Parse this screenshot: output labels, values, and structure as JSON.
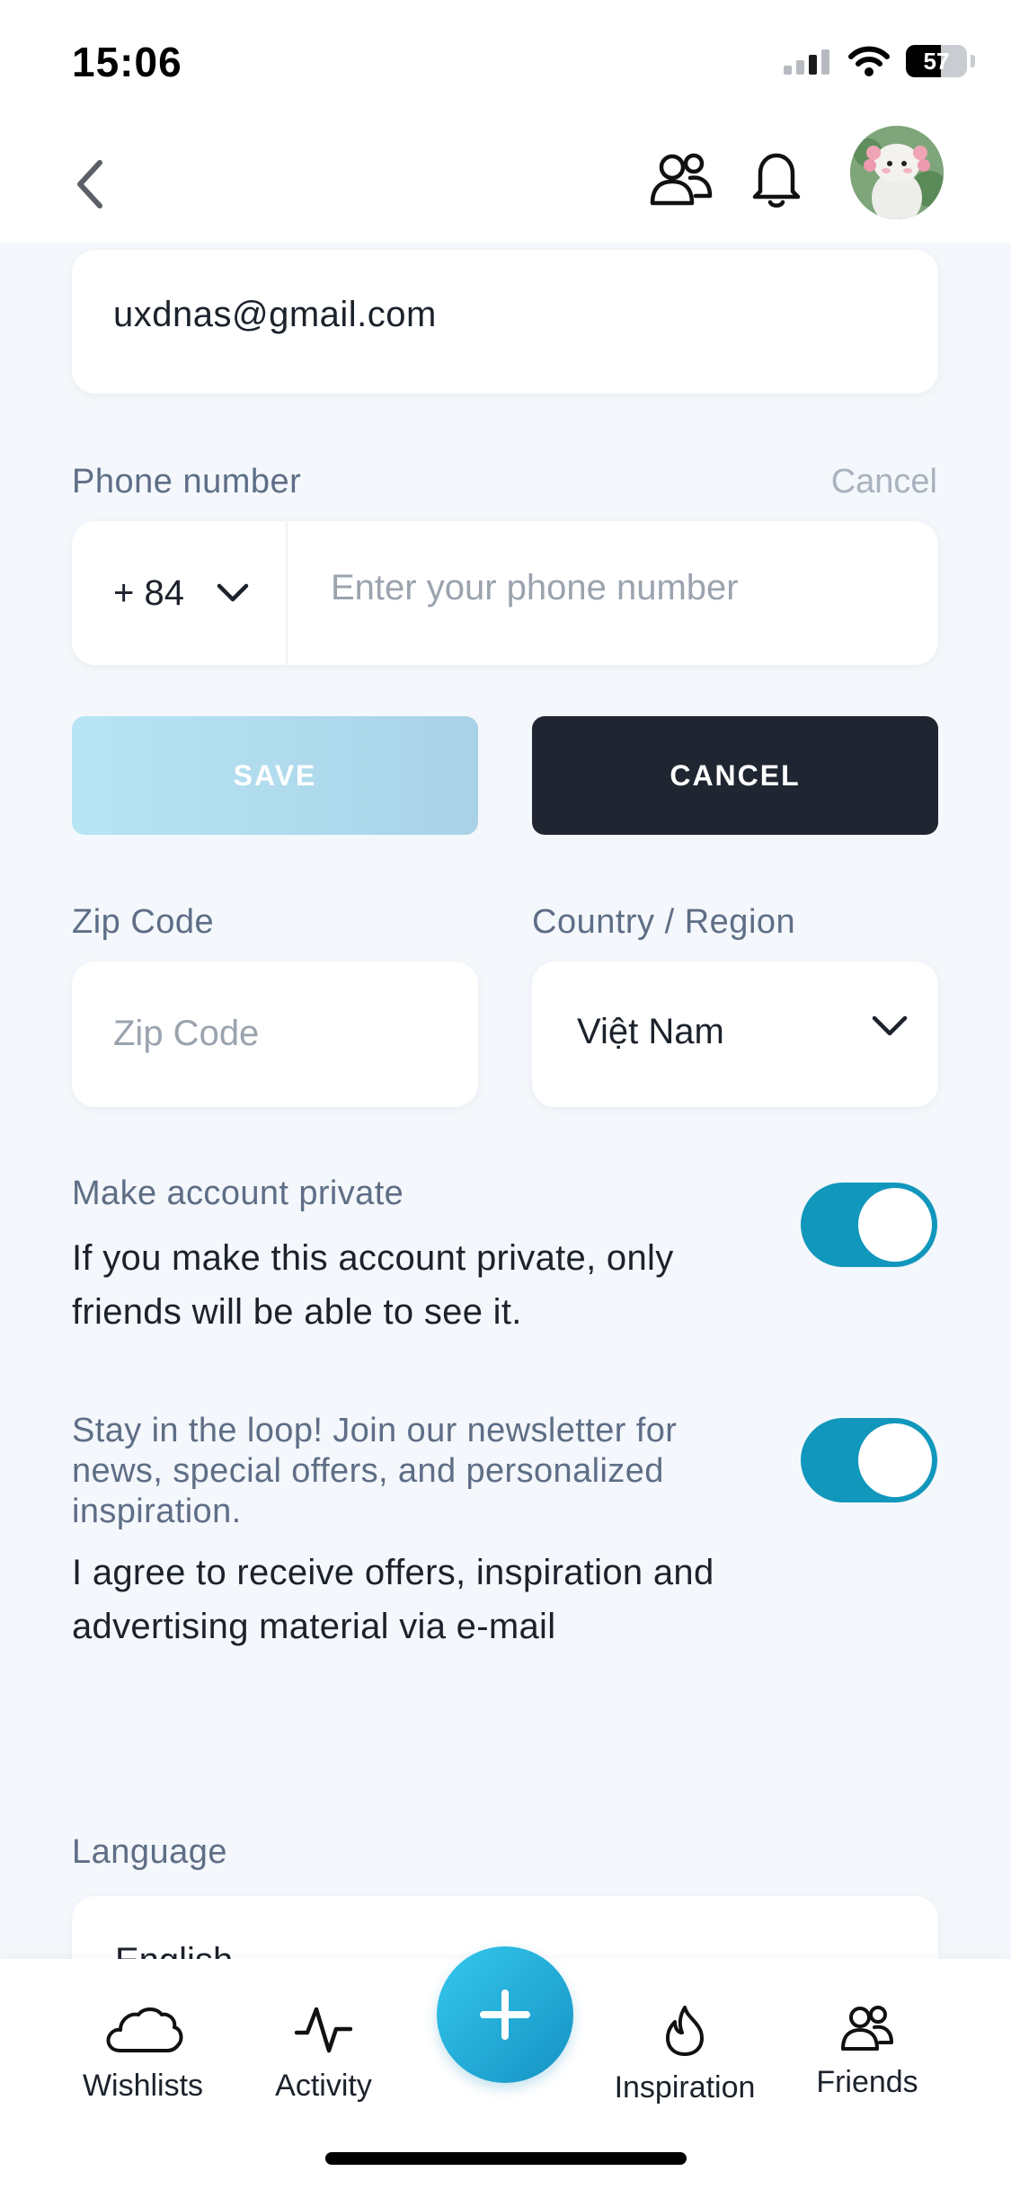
{
  "status_bar": {
    "time": "15:06",
    "battery": "57"
  },
  "account": {
    "email": "uxdnas@gmail.com"
  },
  "phone": {
    "label": "Phone number",
    "cancel_link": "Cancel",
    "country_code": "+ 84",
    "placeholder": "Enter your phone number"
  },
  "buttons": {
    "save": "SAVE",
    "cancel": "CANCEL"
  },
  "zip": {
    "label": "Zip Code",
    "placeholder": "Zip Code"
  },
  "country": {
    "label": "Country / Region",
    "value": "Việt Nam"
  },
  "privacy": {
    "label": "Make account private",
    "description": "If you make this account private, only friends will be able to see it.",
    "enabled": true
  },
  "newsletter": {
    "label": "Stay in the loop! Join our newsletter for news, special offers, and personalized inspiration.",
    "description": "I agree to receive offers, inspiration and advertising material via e-mail",
    "enabled": true
  },
  "language": {
    "label": "Language",
    "value": "English"
  },
  "tab_bar": {
    "items": [
      {
        "label": "Wishlists",
        "icon": "cloud-icon"
      },
      {
        "label": "Activity",
        "icon": "activity-icon"
      },
      {
        "label": "Inspiration",
        "icon": "flame-icon"
      },
      {
        "label": "Friends",
        "icon": "friends-icon"
      }
    ],
    "fab_icon": "plus-icon"
  },
  "colors": {
    "accent": "#1297BC",
    "dark_button": "#202631",
    "background": "#F4F7FB",
    "muted_label": "#5E6E86"
  }
}
